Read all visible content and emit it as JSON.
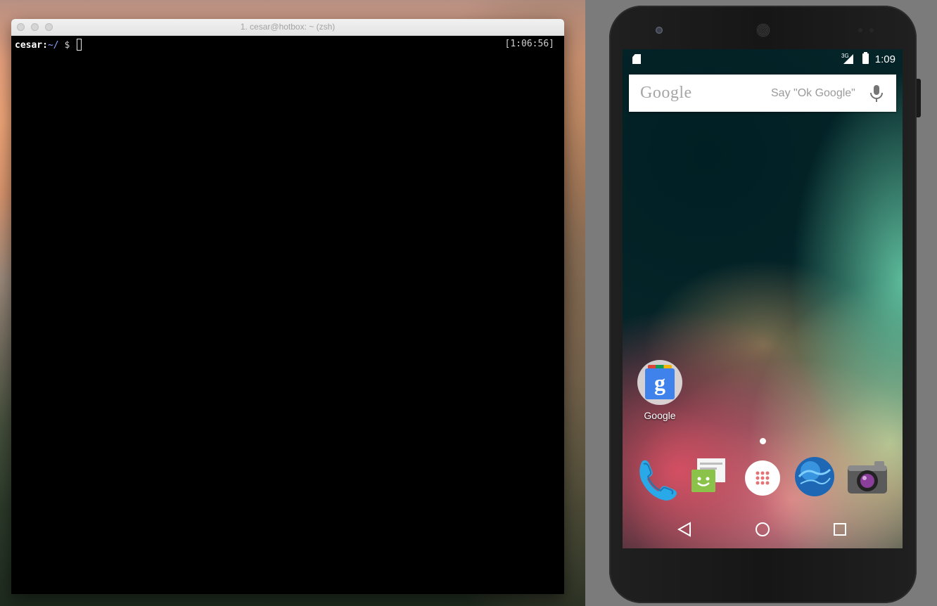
{
  "terminal": {
    "window_title": "1. cesar@hotbox: ~ (zsh)",
    "prompt_user": "cesar",
    "prompt_sep": ":",
    "prompt_path": "~/",
    "prompt_symbol": " $ ",
    "right_prompt_time": "[1:06:56]"
  },
  "android": {
    "status_bar": {
      "network_type": "3G",
      "time": "1:09",
      "icons": [
        "sd-card-icon",
        "signal-icon",
        "battery-icon"
      ]
    },
    "search_widget": {
      "brand": "Google",
      "hint": "Say \"Ok Google\"",
      "icon": "mic-icon"
    },
    "home": {
      "folder_label": "Google",
      "folder_tile_glyph": "g"
    },
    "dock_apps": [
      "phone-icon",
      "messenger-icon",
      "app-drawer-icon",
      "browser-icon",
      "camera-icon"
    ],
    "nav_buttons": [
      "back-icon",
      "home-icon",
      "recents-icon"
    ],
    "colors": {
      "terminal_bg": "#000000",
      "prompt_path": "#8aa6ff",
      "widget_bg": "#ffffff",
      "google_blue": "#3f82ec"
    }
  }
}
